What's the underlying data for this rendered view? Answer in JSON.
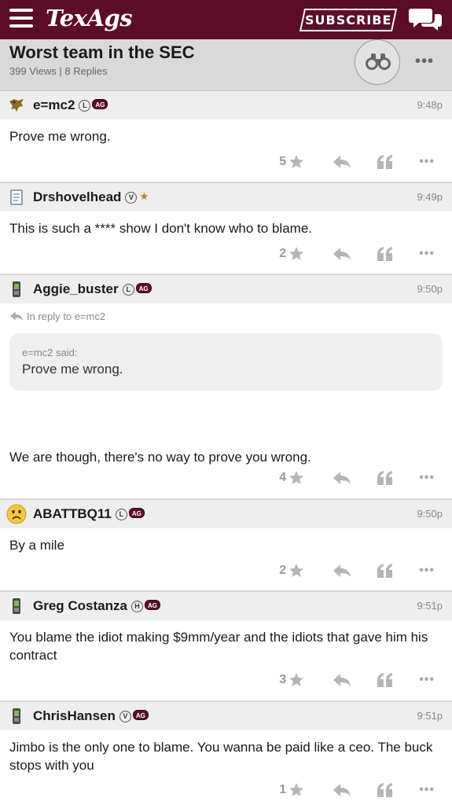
{
  "header": {
    "logo_text": "TexAgs",
    "subscribe_label": "SUBSCRIBE",
    "brand_color": "#5c0d28"
  },
  "thread": {
    "title": "Worst team in the SEC",
    "views": "399 Views",
    "separator": "|",
    "replies": "8 Replies",
    "more_label": "•••"
  },
  "posts": [
    {
      "username": "e=mc2",
      "badge": "L",
      "tag": "AG",
      "time": "9:48p",
      "avatar_icon": "eagle-icon",
      "body": "Prove me wrong.",
      "likes": "5"
    },
    {
      "username": "Drshovelhead",
      "badge": "V",
      "tag": "★",
      "time": "9:49p",
      "avatar_icon": "notepad-icon",
      "body": "This is such a **** show I don't know who to blame.",
      "likes": "2"
    },
    {
      "username": "Aggie_buster",
      "badge": "L",
      "tag": "AG",
      "time": "9:50p",
      "avatar_icon": "phone-icon",
      "reply_to": "In reply to e=mc2",
      "quote_author": "e=mc2 said:",
      "quote_text": "Prove me wrong.",
      "body": "We are though, there's no way to prove you wrong.",
      "likes": "4"
    },
    {
      "username": "ABATTBQ11",
      "badge": "L",
      "tag": "AG",
      "time": "9:50p",
      "avatar_icon": "sad-face-icon",
      "body": "By a mile",
      "likes": "2"
    },
    {
      "username": "Greg Costanza",
      "badge": "H",
      "tag": "AG",
      "time": "9:51p",
      "avatar_icon": "phone-icon",
      "body": "You blame the idiot making $9mm/year and the idiots that gave him his contract",
      "likes": "3"
    },
    {
      "username": "ChrisHansen",
      "badge": "V",
      "tag": "AG",
      "time": "9:51p",
      "avatar_icon": "phone-icon",
      "body": "Jimbo is the only one to blame. You wanna be paid like a ceo. The buck stops with you",
      "likes": "1"
    }
  ],
  "action_more_label": "•••"
}
